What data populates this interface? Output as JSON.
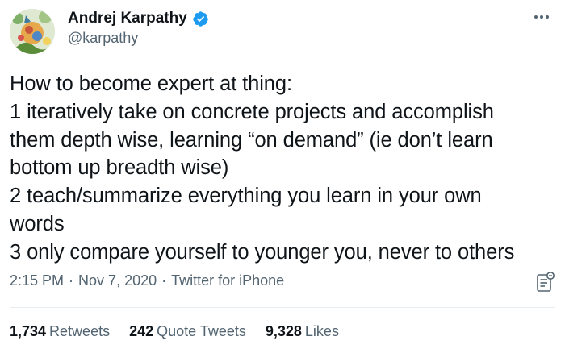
{
  "author": {
    "display_name": "Andrej Karpathy",
    "handle": "@karpathy",
    "verified": true,
    "verified_color": "#1d9bf0"
  },
  "tweet": {
    "lines": [
      "How to become expert at thing:",
      "1 iteratively take on concrete projects and accomplish",
      "them depth wise, learning “on demand” (ie don’t learn",
      "bottom up breadth wise)",
      "2 teach/summarize everything you learn in your own",
      "words",
      "3 only compare yourself to younger you, never to others"
    ]
  },
  "meta": {
    "time": "2:15 PM",
    "date": "Nov 7, 2020",
    "source": "Twitter for iPhone",
    "separator": "·"
  },
  "stats": {
    "retweets_count": "1,734",
    "retweets_label": "Retweets",
    "quote_tweets_count": "242",
    "quote_tweets_label": "Quote Tweets",
    "likes_count": "9,328",
    "likes_label": "Likes"
  },
  "icons": {
    "more": "more-horizontal-icon",
    "analytics": "analytics-icon",
    "verified": "verified-badge-icon"
  },
  "colors": {
    "text_primary": "#0f1419",
    "text_secondary": "#536471",
    "divider": "#e6ecf0"
  }
}
